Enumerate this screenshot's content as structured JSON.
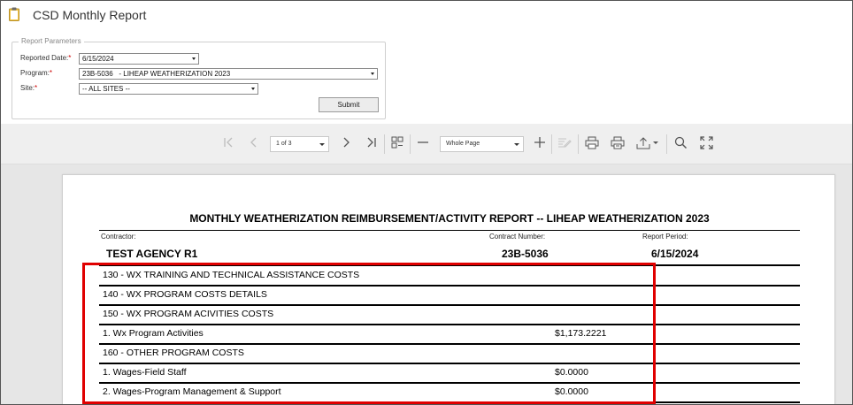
{
  "app": {
    "title": "CSD Monthly Report",
    "icon": "clipboard-icon"
  },
  "params": {
    "legend": "Report Parameters",
    "reported_date": {
      "label": "Reported Date:",
      "value": "6/15/2024"
    },
    "program": {
      "label": "Program:",
      "value": "23B-5036   - LIHEAP WEATHERIZATION 2023"
    },
    "site": {
      "label": "Site:",
      "value": "-- ALL SITES --"
    },
    "required_mark": "*",
    "submit_label": "Submit"
  },
  "toolbar": {
    "page_select": "1 of 3",
    "zoom_select": "Whole Page",
    "icons": [
      "first-page-icon",
      "prev-page-icon",
      "next-page-icon",
      "last-page-icon",
      "thumbnails-icon",
      "zoom-out-icon",
      "zoom-in-icon",
      "edit-form-icon",
      "print-icon",
      "print-page-icon",
      "export-icon",
      "search-icon",
      "fullscreen-icon"
    ]
  },
  "report": {
    "title": "MONTHLY WEATHERIZATION REIMBURSEMENT/ACTIVITY REPORT -- LIHEAP WEATHERIZATION 2023",
    "contractor_label": "Contractor:",
    "contractor_value": "TEST AGENCY R1",
    "contract_number_label": "Contract Number:",
    "contract_number_value": "23B-5036",
    "report_period_label": "Report Period:",
    "report_period_value": "6/15/2024",
    "rows": [
      {
        "text": "130 - WX TRAINING AND TECHNICAL ASSISTANCE COSTS",
        "amount": ""
      },
      {
        "text": "140 - WX PROGRAM COSTS DETAILS",
        "amount": ""
      },
      {
        "text": "150 - WX PROGRAM ACIVITIES COSTS",
        "amount": ""
      },
      {
        "text": "1. Wx Program Activities",
        "amount": "$1,173.2221"
      },
      {
        "text": "160 - OTHER PROGRAM COSTS",
        "amount": ""
      },
      {
        "text": "1. Wages-Field Staff",
        "amount": "$0.0000"
      },
      {
        "text": "2. Wages-Program Management & Support",
        "amount": "$0.0000"
      }
    ]
  },
  "colors": {
    "highlight": "#e00000",
    "required": "#cc0000",
    "viewer_bg": "#e6e6e6"
  }
}
